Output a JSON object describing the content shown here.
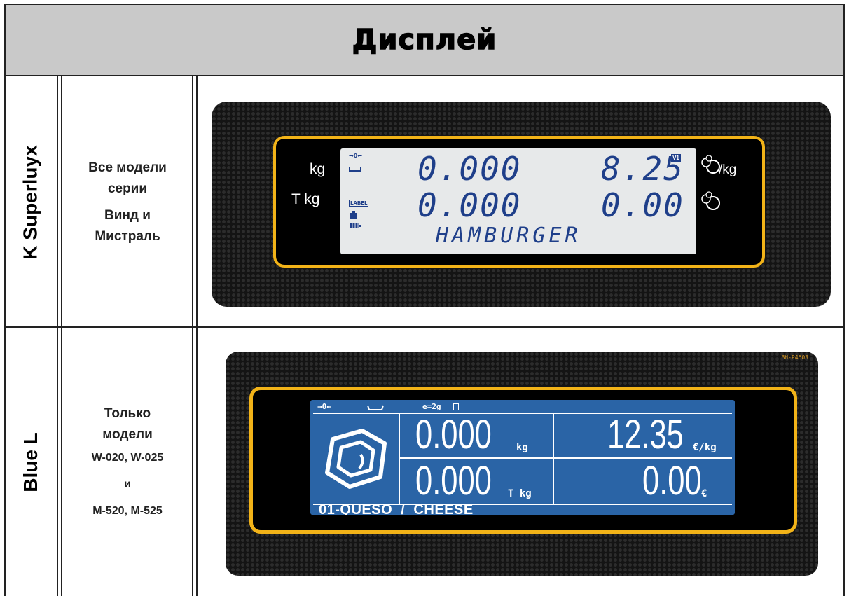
{
  "header": {
    "title": "Дисплей"
  },
  "rows": [
    {
      "label": "K Superluyx",
      "desc": [
        "Все модели",
        "серии",
        "Винд и",
        "Мистраль"
      ]
    },
    {
      "label": "Blue L",
      "desc": [
        "Только",
        "модели",
        "W-020, W-025",
        "и",
        "M-520, M-525"
      ]
    }
  ],
  "display1": {
    "left_units": [
      "kg",
      "T kg"
    ],
    "right_units": [
      "/kg",
      ""
    ],
    "status_icons": [
      "→0←",
      "LABEL"
    ],
    "badge": "V1",
    "weight": "0.000",
    "tare": "0.000",
    "price": "8.25",
    "total": "0.00",
    "product": "HAMBURGER"
  },
  "display2": {
    "model_tag": "BH-P4603",
    "status": [
      "→0←",
      "e=2g"
    ],
    "weight": "0.000",
    "weight_unit": "kg",
    "tare": "0.000",
    "tare_unit": "T kg",
    "price": "12.35",
    "price_unit": "€/kg",
    "total": "0.00",
    "total_unit": "€",
    "product": "01-QUESO  /  CHEESE"
  },
  "colors": {
    "bezel": "#f2b318",
    "lcd1_bg": "#e7e9ea",
    "lcd1_digits": "#1f3f8a",
    "lcd2_bg": "#2a64a6",
    "header_bg": "#c9c9c9"
  }
}
